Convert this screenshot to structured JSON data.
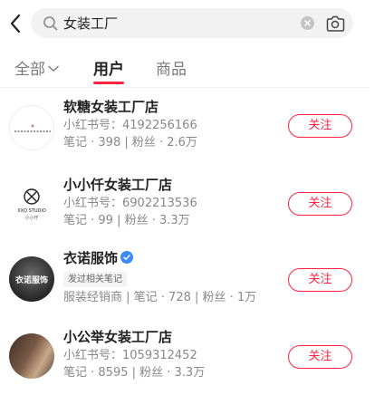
{
  "search": {
    "query": "女装工厂",
    "placeholder": ""
  },
  "tabs": [
    {
      "label": "全部",
      "active": false
    },
    {
      "label": "用户",
      "active": true
    },
    {
      "label": "商品",
      "active": false
    }
  ],
  "colors": {
    "accent": "#ff2442",
    "verified": "#3d8af7"
  },
  "results": [
    {
      "name": "软糖女装工厂店",
      "line1": "小红书号：4192256166",
      "line2": "笔记 · 398 | 粉丝 · 2.6万",
      "follow_label": "关注"
    },
    {
      "name": "小小仟女装工厂店",
      "line1": "小红书号：6902213536",
      "line2": "笔记 · 99 | 粉丝 · 3.3万",
      "follow_label": "关注",
      "avatar_text": "XXQ STUDIO",
      "avatar_subtext": "小小仟"
    },
    {
      "name": "衣诺服饰",
      "tag": "发过相关笔记",
      "line2": "服装经销商 | 笔记 · 728 | 粉丝 · 1万",
      "follow_label": "关注",
      "avatar_text": "衣诺服饰"
    },
    {
      "name": "小公举女装工厂店",
      "line1": "小红书号：1059312452",
      "line2": "笔记 · 8595 | 粉丝 · 3.3万",
      "follow_label": "关注"
    }
  ]
}
